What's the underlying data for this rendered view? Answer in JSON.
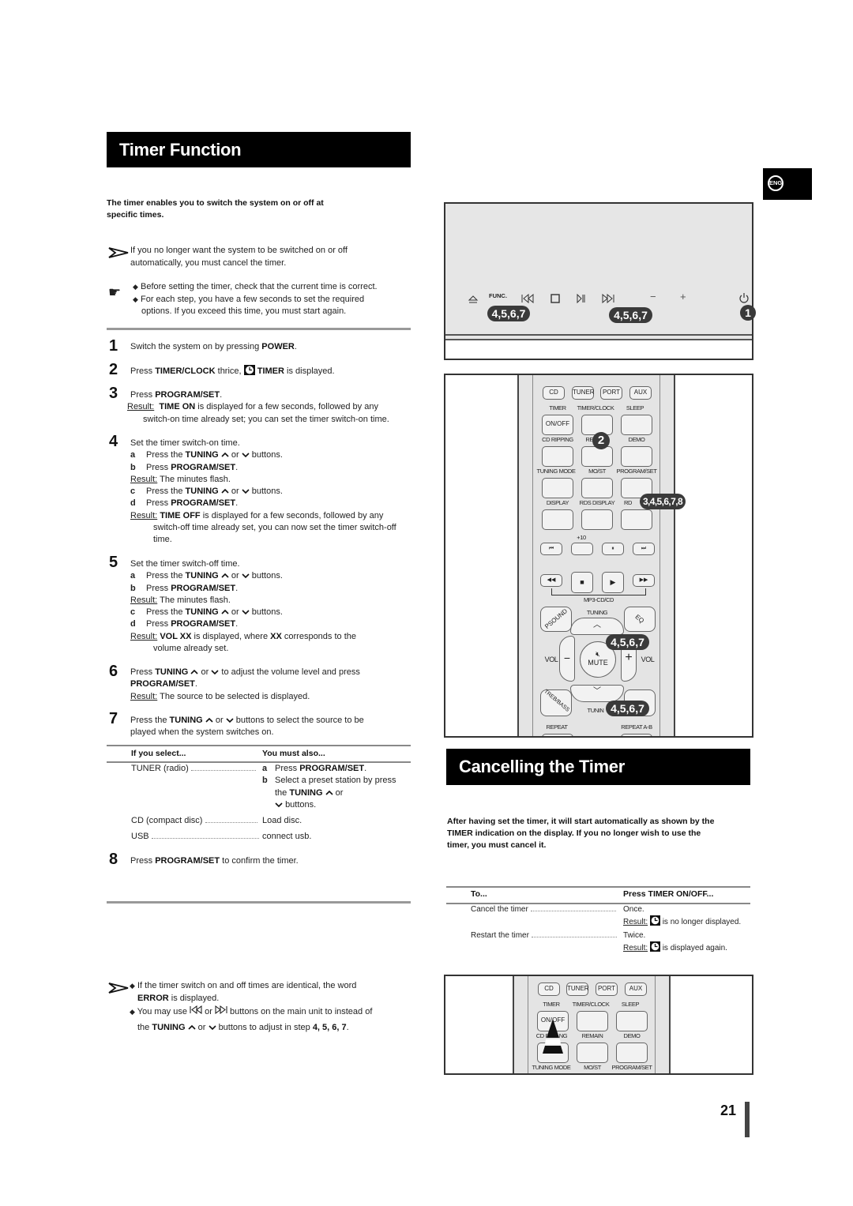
{
  "left": {
    "title": "Timer Function",
    "intro": [
      "The timer enables you to switch the system on or off at",
      "specific times."
    ],
    "note_arrow": [
      "If you no longer want the system to be switched on or off",
      "automatically, you must cancel the timer."
    ],
    "note_hand": [
      "Before setting the timer, check that the current time is correct.",
      "For each step, you have a few seconds to set the required",
      "options. If you exceed this time, you must start again."
    ],
    "steps": [
      {
        "num": "1",
        "text": "Switch the system on by pressing ",
        "bold": "POWER",
        "end": "."
      },
      {
        "num": "2",
        "pre": "Press ",
        "bold": "TIMER/CLOCK",
        "mid": " thrice, ",
        "bold2": "TIMER",
        "end": " is displayed."
      },
      {
        "num": "3",
        "pre": "Press ",
        "bold": "PROGRAM/SET",
        "end": ".",
        "result_label": "Result:",
        "result_bold": "TIME ON",
        "result_text": " is displayed for a few seconds, followed by any",
        "result_cont": "switch-on time already set; you can set the timer switch-on time."
      },
      {
        "num": "4",
        "text": "Set the timer switch-on time.",
        "a": "Press the ",
        "tuning": "TUNING",
        "or": "or",
        "buttons": "buttons.",
        "b_pre": "Press ",
        "prog": "PROGRAM/SET",
        "dot": ".",
        "result_label": "Result:",
        "result_min": "The minutes flash.",
        "result2_bold": "TIME OFF",
        "result2_text": " is displayed for a few seconds, followed by any",
        "result2_cont1": "switch-off time already set, you can now set the timer switch-off",
        "result2_cont2": "time."
      },
      {
        "num": "5",
        "text": "Set the timer switch-off time.",
        "result3_bold": "VOL XX",
        "result3_mid": " is displayed, where ",
        "result3_bold2": "XX",
        "result3_text": " corresponds to the",
        "result3_cont": "volume already set."
      },
      {
        "num": "6",
        "pre": "Press ",
        "bold": "TUNING",
        "text": " to adjust the volume level and press",
        "bold2": "PROGRAM/SET",
        "result_text": "The source to be selected is displayed."
      },
      {
        "num": "7",
        "pre": "Press the ",
        "bold": "TUNING",
        "text": " buttons to select the source to be",
        "cont": "played when the system switches on."
      },
      {
        "num": "8",
        "pre": "Press ",
        "bold": "PROGRAM/SET",
        "text": " to confirm the timer."
      }
    ],
    "letters": [
      "a",
      "b",
      "c",
      "d"
    ],
    "table": {
      "headers": [
        "If you select...",
        "You must also..."
      ],
      "rows": [
        {
          "select": "TUNER (radio)",
          "a": "Press ",
          "a_bold": "PROGRAM/SET",
          "b": "Select a preset station by press",
          "b2_pre": "the ",
          "b2_bold": "TUNING",
          "b2_or": "or",
          "b3": "buttons."
        },
        {
          "select": "CD (compact disc)",
          "action": "Load disc."
        },
        {
          "select": "USB",
          "action": "connect usb."
        }
      ]
    },
    "bottom_note": {
      "l1": "If the timer switch on and off times are identical, the word",
      "l2_bold": "ERROR",
      "l2": " is displayed.",
      "l3_pre": "You may use ",
      "l3_or": " or ",
      "l3_post": "  buttons on the main unit to instead of",
      "l4_pre": "the ",
      "l4_bold": "TUNING",
      "l4_or": "or",
      "l4_post": "buttons to adjust in step ",
      "l4_steps": "4, 5, 6, 7",
      "l4_end": "."
    }
  },
  "right": {
    "lang_badge": "ENG",
    "unit_panel": {
      "func_label": "FUNC.",
      "badges": [
        "4,5,6,7",
        "4,5,6,7",
        "1"
      ]
    },
    "remote": {
      "row1": [
        "CD",
        "TUNER",
        "PORT",
        "AUX"
      ],
      "labels2": [
        "TIMER",
        "TIMER/CLOCK",
        "SLEEP"
      ],
      "onoff": "ON/OFF",
      "labels3": [
        "CD RIPPING",
        "REI",
        "DEMO"
      ],
      "labels4": [
        "TUNING MODE",
        "MO/ST",
        "PROGRAM/SET"
      ],
      "labels5": [
        "DISPLAY",
        "RDS DISPLAY",
        "RD"
      ],
      "plus10": "+10",
      "mp3": "MP3-CD/CD",
      "psound": "PSOUND",
      "tuning": "TUNING",
      "eq": "EQ",
      "vol": "VOL",
      "mute": "MUTE",
      "treb": "TREB/BASS",
      "tunin": "TUNIN",
      "repeat": "REPEAT",
      "repeat_ab": "REPEAT A-B",
      "badges": [
        "2",
        "3,4,5,6,7,8",
        "4,5,6,7",
        "4,5,6,7"
      ]
    },
    "title": "Cancelling the Timer",
    "intro": [
      "After having set the timer, it will start automatically as shown by the",
      "TIMER indication on the display. If you no longer wish to use the",
      "timer, you must cancel it."
    ],
    "table": {
      "headers": [
        "To...",
        "Press TIMER ON/OFF..."
      ],
      "rows": [
        {
          "to": "Cancel the timer",
          "press": "Once.",
          "result_label": "Result:",
          "result_text": "is no longer displayed."
        },
        {
          "to": "Restart the timer",
          "press": "Twice.",
          "result_label": "Result:",
          "result_text": "is displayed again."
        }
      ]
    },
    "remote2": {
      "row1": [
        "CD",
        "TUNER",
        "PORT",
        "AUX"
      ],
      "labels2": [
        "TIMER",
        "TIMER/CLOCK",
        "SLEEP"
      ],
      "onoff": "ON/OFF",
      "labels3": [
        "CD RI",
        "NG",
        "REMAIN",
        "DEMO"
      ],
      "labels4": [
        "TUNING MODE",
        "MO/ST",
        "PROGRAM/SET"
      ]
    },
    "page_number": "21"
  }
}
